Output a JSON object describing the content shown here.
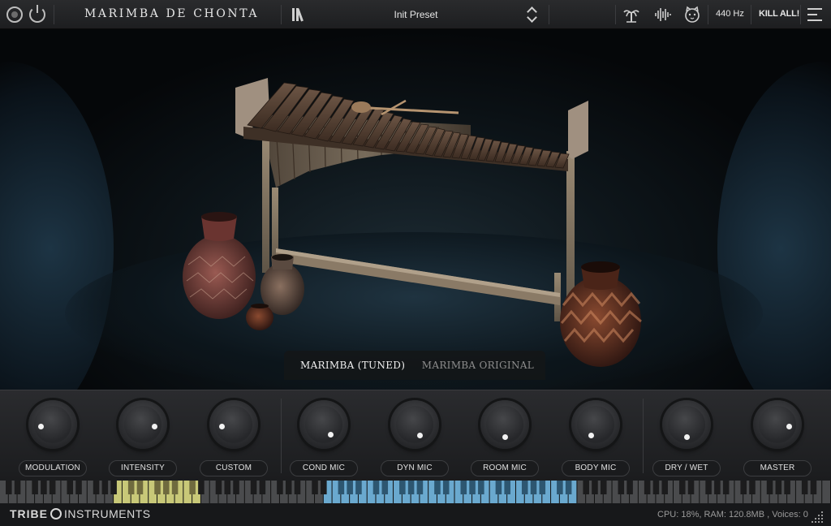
{
  "app": {
    "title": "MARIMBA DE CHONTA",
    "preset": "Init Preset",
    "tuning": "440 Hz",
    "kill_all": "KILL ALL!"
  },
  "topbar_icons": [
    "record-icon",
    "power-icon",
    "library-icon",
    "preset-arrows-icon",
    "palm-tree-icon",
    "waveform-icon",
    "cat-face-icon",
    "menu-icon"
  ],
  "mode_tabs": [
    {
      "label": "MARIMBA (TUNED)",
      "active": true
    },
    {
      "label": "MARIMBA ORIGINAL",
      "active": false
    }
  ],
  "knobs": [
    {
      "label": "MODULATION",
      "value": 0.2
    },
    {
      "label": "INTENSITY",
      "value": 0.8
    },
    {
      "label": "CUSTOM",
      "value": 0.2
    },
    {
      "label": "COND MIC",
      "value": 0.62
    },
    {
      "label": "DYN MIC",
      "value": 0.6
    },
    {
      "label": "ROOM MIC",
      "value": 0.5
    },
    {
      "label": "BODY MIC",
      "value": 0.42
    },
    {
      "label": "DRY / WET",
      "value": 0.5
    },
    {
      "label": "MASTER",
      "value": 0.8
    }
  ],
  "keyboard": {
    "highlight_yellow": "#c8c878",
    "highlight_blue": "#6aa9cf"
  },
  "footer": {
    "brand_left": "TRIBE",
    "brand_right": "INSTRUMENTS",
    "stats": "CPU: 18%, RAM: 120.8MB , Voices: 0"
  }
}
